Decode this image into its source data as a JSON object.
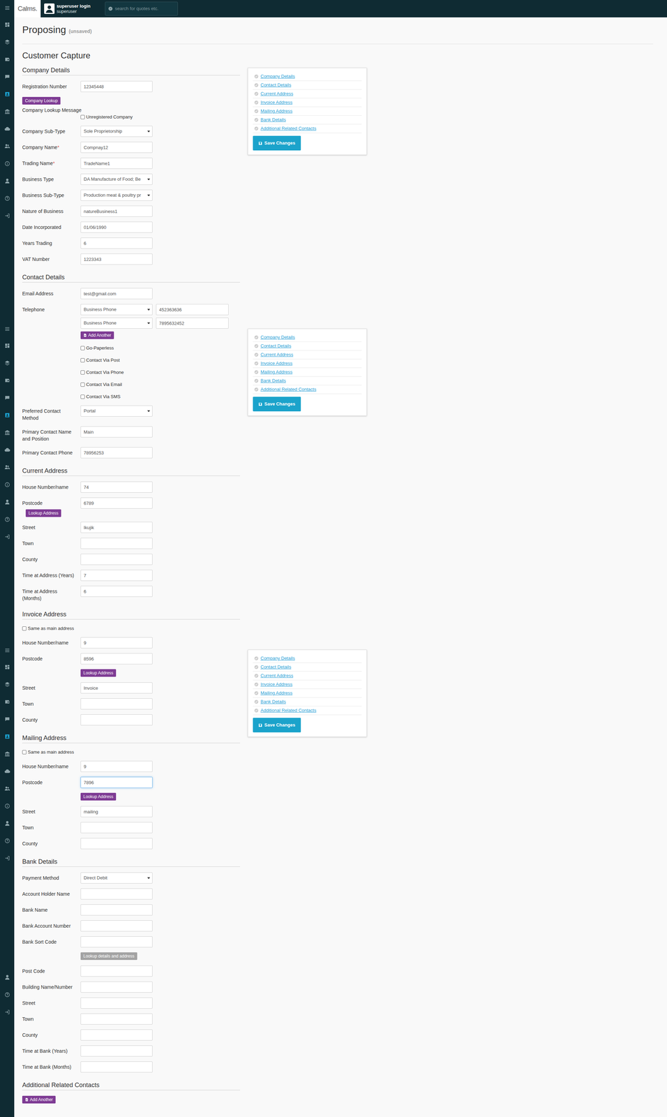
{
  "topbar": {
    "logo": "Calms.",
    "user": {
      "title": "superuser login",
      "name": "superuser"
    },
    "search": {
      "placeholder": "search for quotes etc."
    }
  },
  "sidebar": {
    "groups": [
      {
        "items": [
          {
            "kind": "menu",
            "selected": false
          },
          {
            "kind": "dashboard",
            "selected": false
          },
          {
            "kind": "layers",
            "selected": false
          },
          {
            "kind": "wallet",
            "selected": false
          },
          {
            "kind": "chat",
            "selected": false
          },
          {
            "kind": "contact",
            "selected": true
          },
          {
            "kind": "bank",
            "selected": false
          },
          {
            "kind": "cloud",
            "selected": false
          },
          {
            "kind": "people",
            "selected": false
          },
          {
            "kind": "info",
            "selected": false
          },
          {
            "kind": "person",
            "selected": false
          },
          {
            "kind": "help",
            "selected": false
          },
          {
            "kind": "exit",
            "selected": false
          }
        ]
      },
      {
        "items": [
          {
            "kind": "menu",
            "selected": false
          },
          {
            "kind": "dashboard",
            "selected": false
          },
          {
            "kind": "layers",
            "selected": false
          },
          {
            "kind": "wallet",
            "selected": false
          },
          {
            "kind": "chat",
            "selected": false
          },
          {
            "kind": "contact",
            "selected": true
          },
          {
            "kind": "bank",
            "selected": false
          },
          {
            "kind": "cloud",
            "selected": false
          },
          {
            "kind": "people",
            "selected": false
          },
          {
            "kind": "info",
            "selected": false
          },
          {
            "kind": "person",
            "selected": false
          },
          {
            "kind": "help",
            "selected": false
          },
          {
            "kind": "exit",
            "selected": false
          }
        ]
      },
      {
        "items": [
          {
            "kind": "menu",
            "selected": false
          },
          {
            "kind": "dashboard",
            "selected": false
          },
          {
            "kind": "layers",
            "selected": false
          },
          {
            "kind": "wallet",
            "selected": false
          },
          {
            "kind": "chat",
            "selected": false
          },
          {
            "kind": "contact",
            "selected": true
          },
          {
            "kind": "bank",
            "selected": false
          },
          {
            "kind": "cloud",
            "selected": false
          },
          {
            "kind": "people",
            "selected": false
          },
          {
            "kind": "info",
            "selected": false
          },
          {
            "kind": "person",
            "selected": false
          },
          {
            "kind": "help",
            "selected": false
          },
          {
            "kind": "exit",
            "selected": false
          }
        ]
      },
      {
        "items": [
          {
            "kind": "person",
            "selected": false
          },
          {
            "kind": "help",
            "selected": false
          },
          {
            "kind": "exit",
            "selected": false
          }
        ]
      }
    ]
  },
  "page": {
    "title": "Proposing",
    "status": "(unsaved)",
    "subtitle": "Customer Capture"
  },
  "sections": [
    {
      "title": "Company Details",
      "fields": [
        {
          "kind": "text",
          "label": "Registration Number",
          "value": "12345448",
          "focused": false
        },
        {
          "kind": "button",
          "text": "Company Lookup",
          "disabled": false
        },
        {
          "kind": "note",
          "text": "Company Lookup Message"
        },
        {
          "kind": "checkbox",
          "text": "Unregistered Company",
          "checked": false
        },
        {
          "kind": "select",
          "label": "Company Sub-Type",
          "value": "Sole Proprietorship"
        },
        {
          "kind": "text",
          "label": "Company Name",
          "marker": "*",
          "value": "Compnay12",
          "focused": false
        },
        {
          "kind": "text",
          "label": "Trading Name",
          "marker": "*",
          "value": "TradeName1",
          "focused": false
        },
        {
          "kind": "select",
          "label": "Business Type",
          "value": "DA Manufacture of Food; Be"
        },
        {
          "kind": "select",
          "label": "Business Sub-Type",
          "value": "Production meat & poultry pr"
        },
        {
          "kind": "text",
          "label": "Nature of Business",
          "value": "natureBusiness1",
          "focused": false
        },
        {
          "kind": "text",
          "label": "Date Incorporated",
          "value": "01/06/1990",
          "focused": false
        },
        {
          "kind": "text",
          "label": "Years Trading",
          "value": "6",
          "focused": false
        },
        {
          "kind": "text",
          "label": "VAT Number",
          "value": "1223343",
          "focused": false
        }
      ]
    },
    {
      "title": "Contact Details",
      "fields": [
        {
          "kind": "text",
          "label": "Email Address",
          "value": "test@gmail.com",
          "focused": false
        },
        {
          "kind": "phone",
          "label": "Telephone",
          "lines": [
            {
              "type": "Business Phone",
              "number": "452363636"
            },
            {
              "type": "Business Phone",
              "number": "7895632452"
            }
          ]
        },
        {
          "kind": "field-add-button",
          "text": "Add Another",
          "disabled": false
        },
        {
          "kind": "checkbox",
          "text": "Go-Paperless",
          "checked": false
        },
        {
          "kind": "checkbox",
          "text": "Contact Via Post",
          "checked": false
        },
        {
          "kind": "checkbox",
          "text": "Contact Via Phone",
          "checked": false
        },
        {
          "kind": "checkbox",
          "text": "Contact Via Email",
          "checked": false
        },
        {
          "kind": "checkbox",
          "text": "Contact Via SMS",
          "checked": false
        },
        {
          "kind": "select",
          "label": "Preferred Contact Method",
          "value": "Portal"
        },
        {
          "kind": "text",
          "label": "Primary Contact Name and Position",
          "value": "Main",
          "focused": false
        },
        {
          "kind": "text",
          "label": "Primary Contact Phone",
          "value": "78956253",
          "focused": false
        }
      ]
    },
    {
      "title": "Current Address",
      "fields": [
        {
          "kind": "text",
          "label": "House Number/name",
          "value": "74",
          "focused": false
        },
        {
          "kind": "text",
          "label": "Postcode",
          "value": "6789",
          "focused": false,
          "button": "Lookup Address"
        },
        {
          "kind": "text",
          "label": "Street",
          "value": "Ikujik",
          "focused": false
        },
        {
          "kind": "text",
          "label": "Town",
          "value": "",
          "focused": false
        },
        {
          "kind": "text",
          "label": "County",
          "value": "",
          "focused": false
        },
        {
          "kind": "text",
          "label": "Time at Address (Years)",
          "value": "7",
          "focused": false
        },
        {
          "kind": "text",
          "label": "Time at Address (Months)",
          "value": "6",
          "focused": false
        }
      ]
    },
    {
      "title": "Invoice Address",
      "fields": [
        {
          "kind": "section-checkbox",
          "text": "Same as main address",
          "checked": false
        },
        {
          "kind": "text",
          "label": "House Number/name",
          "value": "9",
          "focused": false
        },
        {
          "kind": "text",
          "label": "Postcode",
          "value": "8596",
          "focused": false
        },
        {
          "kind": "field-button",
          "text": "Lookup Address",
          "disabled": false
        },
        {
          "kind": "text",
          "label": "Street",
          "value": "Invoice",
          "focused": false
        },
        {
          "kind": "text",
          "label": "Town",
          "value": "",
          "focused": false
        },
        {
          "kind": "text",
          "label": "County",
          "value": "",
          "focused": false
        }
      ]
    },
    {
      "title": "Mailing Address",
      "fields": [
        {
          "kind": "section-checkbox",
          "text": "Same as main address",
          "checked": false
        },
        {
          "kind": "text",
          "label": "House Number/name",
          "value": "9",
          "focused": false
        },
        {
          "kind": "text",
          "label": "Postcode",
          "value": "7896",
          "focused": true
        },
        {
          "kind": "field-button",
          "text": "Lookup Address",
          "disabled": false
        },
        {
          "kind": "text",
          "label": "Street",
          "value": "mailing",
          "focused": false
        },
        {
          "kind": "text",
          "label": "Town",
          "value": "",
          "focused": false
        },
        {
          "kind": "text",
          "label": "County",
          "value": "",
          "focused": false
        }
      ]
    },
    {
      "title": "Bank Details",
      "fields": [
        {
          "kind": "select",
          "label": "Payment Method",
          "value": "Direct Debit"
        },
        {
          "kind": "text",
          "label": "Account Holder Name",
          "value": "",
          "focused": false
        },
        {
          "kind": "text",
          "label": "Bank Name",
          "value": "",
          "focused": false
        },
        {
          "kind": "text",
          "label": "Bank Account Number",
          "value": "",
          "focused": false
        },
        {
          "kind": "text",
          "label": "Bank Sort Code",
          "value": "",
          "focused": false
        },
        {
          "kind": "field-button",
          "text": "Lookup details and address",
          "disabled": true
        },
        {
          "kind": "text",
          "label": "Post Code",
          "value": "",
          "focused": false
        },
        {
          "kind": "text",
          "label": "Building Name/Number",
          "value": "",
          "focused": false
        },
        {
          "kind": "text",
          "label": "Street",
          "value": "",
          "focused": false
        },
        {
          "kind": "text",
          "label": "Town",
          "value": "",
          "focused": false
        },
        {
          "kind": "text",
          "label": "County",
          "value": "",
          "focused": false
        },
        {
          "kind": "text",
          "label": "Time at Bank (Years)",
          "value": "",
          "focused": false
        },
        {
          "kind": "text",
          "label": "Time at Bank (Months)",
          "value": "",
          "focused": false
        }
      ]
    },
    {
      "title": "Additional Related Contacts",
      "fields": [
        {
          "kind": "add-button",
          "text": "Add Another",
          "disabled": false
        }
      ]
    }
  ],
  "nav_panels": [
    {
      "links": [
        {
          "label": "Company Details",
          "complete": false
        },
        {
          "label": "Contact Details",
          "complete": false
        },
        {
          "label": "Current Address",
          "complete": false
        },
        {
          "label": "Invoice Address",
          "complete": false
        },
        {
          "label": "Mailing Address",
          "complete": false
        },
        {
          "label": "Bank Details",
          "complete": false
        },
        {
          "label": "Additional Related Contacts",
          "complete": false
        }
      ],
      "save": "Save Changes"
    },
    {
      "links": [
        {
          "label": "Company Details",
          "complete": false
        },
        {
          "label": "Contact Details",
          "complete": false
        },
        {
          "label": "Current Address",
          "complete": false
        },
        {
          "label": "Invoice Address",
          "complete": false
        },
        {
          "label": "Mailing Address",
          "complete": false
        },
        {
          "label": "Bank Details",
          "complete": false
        },
        {
          "label": "Additional Related Contacts",
          "complete": false
        }
      ],
      "save": "Save Changes"
    },
    {
      "links": [
        {
          "label": "Company Details",
          "complete": false
        },
        {
          "label": "Contact Details",
          "complete": false
        },
        {
          "label": "Current Address",
          "complete": false
        },
        {
          "label": "Invoice Address",
          "complete": false
        },
        {
          "label": "Mailing Address",
          "complete": false
        },
        {
          "label": "Bank Details",
          "complete": false
        },
        {
          "label": "Additional Related Contacts",
          "complete": false
        }
      ],
      "save": "Save Changes"
    }
  ]
}
